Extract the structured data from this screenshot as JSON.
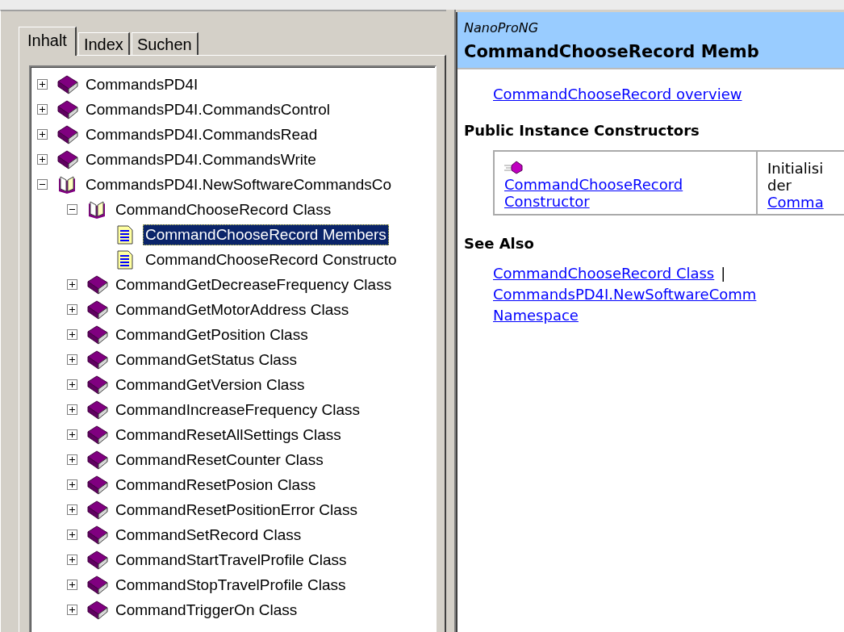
{
  "tabs": [
    {
      "label": "Inhalt",
      "selected": true
    },
    {
      "label": "Index",
      "selected": false
    },
    {
      "label": "Suchen",
      "selected": false
    }
  ],
  "tree": [
    {
      "label": "CommandsPD4I",
      "kind": "book",
      "expanded": false,
      "selected": false
    },
    {
      "label": "CommandsPD4I.CommandsControl",
      "kind": "book",
      "expanded": false,
      "selected": false
    },
    {
      "label": "CommandsPD4I.CommandsRead",
      "kind": "book",
      "expanded": false,
      "selected": false
    },
    {
      "label": "CommandsPD4I.CommandsWrite",
      "kind": "book",
      "expanded": false,
      "selected": false
    },
    {
      "label": "CommandsPD4I.NewSoftwareCommandsCo",
      "kind": "book",
      "expanded": true,
      "selected": false,
      "children": [
        {
          "label": "CommandChooseRecord Class",
          "kind": "book",
          "expanded": true,
          "selected": false,
          "children": [
            {
              "label": "CommandChooseRecord Members",
              "kind": "page",
              "selected": true
            },
            {
              "label": "CommandChooseRecord Constructo",
              "kind": "page",
              "selected": false
            }
          ]
        },
        {
          "label": "CommandGetDecreaseFrequency Class",
          "kind": "book",
          "expanded": false,
          "selected": false
        },
        {
          "label": "CommandGetMotorAddress Class",
          "kind": "book",
          "expanded": false,
          "selected": false
        },
        {
          "label": "CommandGetPosition Class",
          "kind": "book",
          "expanded": false,
          "selected": false
        },
        {
          "label": "CommandGetStatus Class",
          "kind": "book",
          "expanded": false,
          "selected": false
        },
        {
          "label": "CommandGetVersion Class",
          "kind": "book",
          "expanded": false,
          "selected": false
        },
        {
          "label": "CommandIncreaseFrequency Class",
          "kind": "book",
          "expanded": false,
          "selected": false
        },
        {
          "label": "CommandResetAllSettings Class",
          "kind": "book",
          "expanded": false,
          "selected": false
        },
        {
          "label": "CommandResetCounter Class",
          "kind": "book",
          "expanded": false,
          "selected": false
        },
        {
          "label": "CommandResetPosion Class",
          "kind": "book",
          "expanded": false,
          "selected": false
        },
        {
          "label": "CommandResetPositionError Class",
          "kind": "book",
          "expanded": false,
          "selected": false
        },
        {
          "label": "CommandSetRecord Class",
          "kind": "book",
          "expanded": false,
          "selected": false
        },
        {
          "label": "CommandStartTravelProfile Class",
          "kind": "book",
          "expanded": false,
          "selected": false
        },
        {
          "label": "CommandStopTravelProfile Class",
          "kind": "book",
          "expanded": false,
          "selected": false
        },
        {
          "label": "CommandTriggerOn Class",
          "kind": "book",
          "expanded": false,
          "selected": false
        }
      ]
    }
  ],
  "page": {
    "product": "NanoProNG",
    "title": "CommandChooseRecord Memb",
    "overview_link": "CommandChooseRecord overview",
    "constructors_heading": "Public Instance Constructors",
    "constructors": [
      {
        "name_lines": [
          "CommandChooseRecord",
          "Constructor"
        ],
        "description": [
          {
            "kind": "text",
            "text": "Initialisi"
          },
          {
            "kind": "text",
            "text": "der"
          },
          {
            "kind": "link",
            "text": "Comma"
          }
        ]
      }
    ],
    "see_also_heading": "See Also",
    "see_also": [
      {
        "kind": "link",
        "text": "CommandChooseRecord Class"
      },
      {
        "kind": "separator",
        "text": "|"
      },
      {
        "kind": "break"
      },
      {
        "kind": "link",
        "text": "CommandsPD4I.NewSoftwareComm"
      },
      {
        "kind": "break"
      },
      {
        "kind": "link",
        "text": "Namespace"
      }
    ]
  }
}
